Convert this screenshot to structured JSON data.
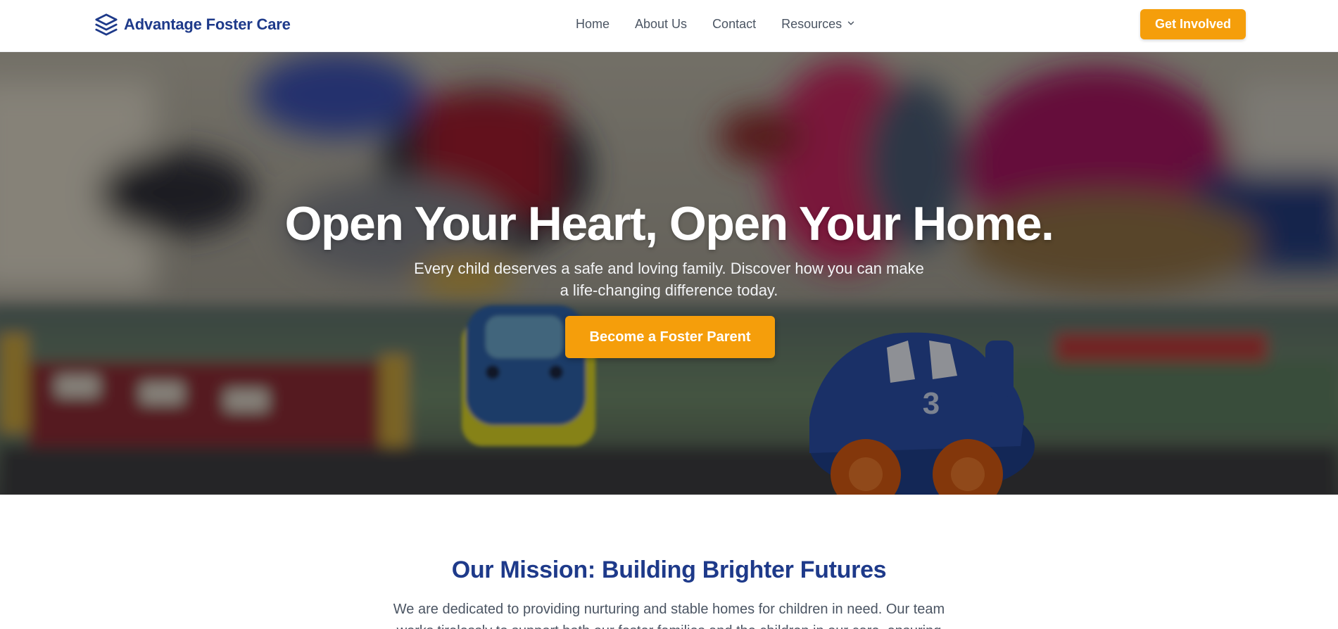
{
  "header": {
    "brand_name": "Advantage Foster Care",
    "brand_icon": "layers-icon",
    "nav": [
      {
        "label": "Home"
      },
      {
        "label": "About Us"
      },
      {
        "label": "Contact"
      },
      {
        "label": "Resources"
      }
    ],
    "cta_label": "Get Involved"
  },
  "hero": {
    "title": "Open Your Heart, Open Your Home.",
    "subtitle": "Every child deserves a safe and loving family. Discover how you can make a life-changing difference today.",
    "cta_label": "Become a Foster Parent",
    "toy_car_number": "3"
  },
  "mission": {
    "title": "Our Mission: Building Brighter Futures",
    "text": "We are dedicated to providing nurturing and stable homes for children in need. Our team works tirelessly to support both our foster families and the children in our care, ensuring"
  },
  "colors": {
    "brand": "#1e3a8a",
    "accent": "#f59e0b",
    "nav_text": "#4b5563"
  }
}
